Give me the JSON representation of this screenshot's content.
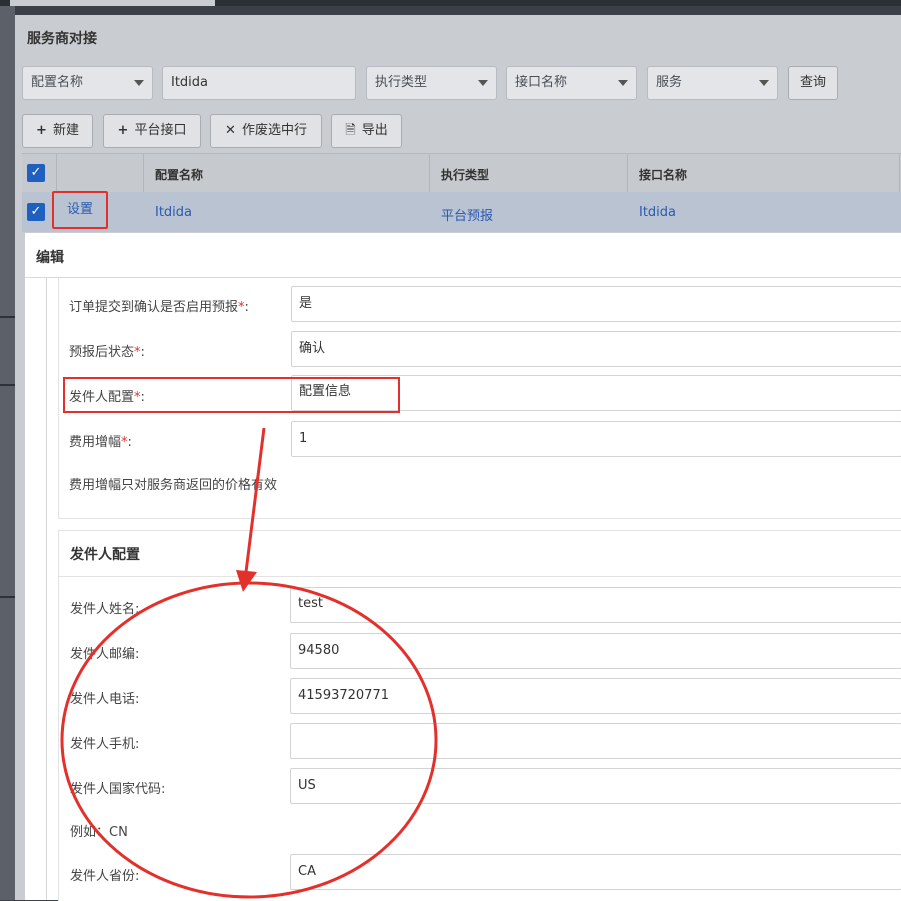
{
  "panel_title": "服务商对接",
  "filters": {
    "config_name_select": "配置名称",
    "name_input_value": "Itdida",
    "exec_type_select": "执行类型",
    "interface_name_select": "接口名称",
    "service_select": "服务",
    "query_button": "查询"
  },
  "toolbar": {
    "new_button": "新建",
    "platform_interface_button": "平台接口",
    "void_selected_button": "作废选中行",
    "export_button": "导出"
  },
  "table": {
    "headers": [
      "配置名称",
      "执行类型",
      "接口名称"
    ],
    "row": {
      "action": "设置",
      "config_name": "Itdida",
      "exec_type": "平台预报",
      "interface_name": "Itdida"
    }
  },
  "modal": {
    "title": "编辑",
    "fields": [
      {
        "label": "订单提交到确认是否启用预报",
        "required": true,
        "value": "是"
      },
      {
        "label": "预报后状态",
        "required": true,
        "value": "确认"
      },
      {
        "label": "发件人配置",
        "required": true,
        "value": "配置信息"
      },
      {
        "label": "费用增幅",
        "required": true,
        "value": "1"
      }
    ],
    "fee_hint": "费用增幅只对服务商返回的价格有效",
    "sender_section": {
      "title": "发件人配置",
      "fields": [
        {
          "label": "发件人姓名",
          "value": "test"
        },
        {
          "label": "发件人邮编",
          "value": "94580"
        },
        {
          "label": "发件人电话",
          "value": "41593720771"
        },
        {
          "label": "发件人手机",
          "value": ""
        },
        {
          "label": "发件人国家代码",
          "value": "US"
        },
        {
          "label": "发件人省份",
          "value": "CA"
        }
      ],
      "country_hint": "例如：CN"
    }
  },
  "colors": {
    "annotation_red": "#e4302b",
    "link_blue": "#2a5ab0",
    "checkbox_blue": "#1f5fbf"
  }
}
